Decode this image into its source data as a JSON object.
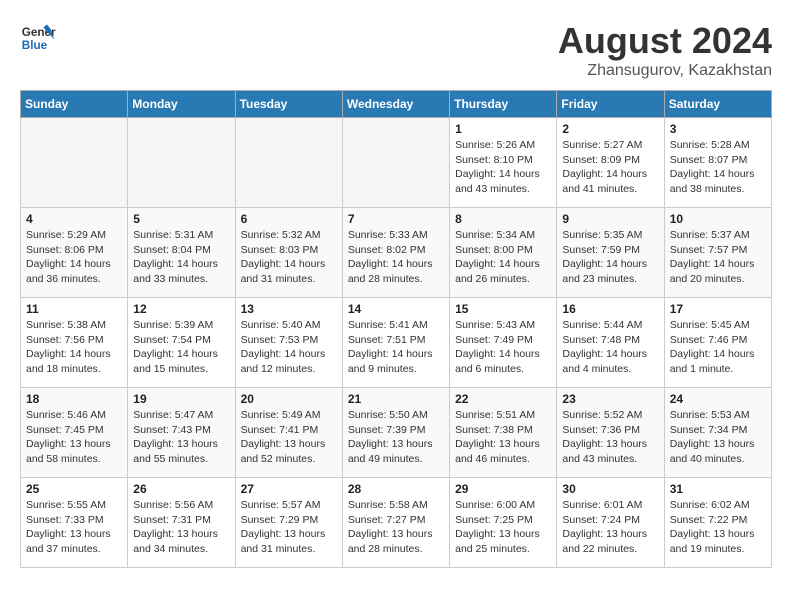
{
  "header": {
    "logo_line1": "General",
    "logo_line2": "Blue",
    "main_title": "August 2024",
    "subtitle": "Zhansugurov, Kazakhstan"
  },
  "calendar": {
    "weekdays": [
      "Sunday",
      "Monday",
      "Tuesday",
      "Wednesday",
      "Thursday",
      "Friday",
      "Saturday"
    ],
    "weeks": [
      [
        {
          "day": "",
          "info": ""
        },
        {
          "day": "",
          "info": ""
        },
        {
          "day": "",
          "info": ""
        },
        {
          "day": "",
          "info": ""
        },
        {
          "day": "1",
          "info": "Sunrise: 5:26 AM\nSunset: 8:10 PM\nDaylight: 14 hours\nand 43 minutes."
        },
        {
          "day": "2",
          "info": "Sunrise: 5:27 AM\nSunset: 8:09 PM\nDaylight: 14 hours\nand 41 minutes."
        },
        {
          "day": "3",
          "info": "Sunrise: 5:28 AM\nSunset: 8:07 PM\nDaylight: 14 hours\nand 38 minutes."
        }
      ],
      [
        {
          "day": "4",
          "info": "Sunrise: 5:29 AM\nSunset: 8:06 PM\nDaylight: 14 hours\nand 36 minutes."
        },
        {
          "day": "5",
          "info": "Sunrise: 5:31 AM\nSunset: 8:04 PM\nDaylight: 14 hours\nand 33 minutes."
        },
        {
          "day": "6",
          "info": "Sunrise: 5:32 AM\nSunset: 8:03 PM\nDaylight: 14 hours\nand 31 minutes."
        },
        {
          "day": "7",
          "info": "Sunrise: 5:33 AM\nSunset: 8:02 PM\nDaylight: 14 hours\nand 28 minutes."
        },
        {
          "day": "8",
          "info": "Sunrise: 5:34 AM\nSunset: 8:00 PM\nDaylight: 14 hours\nand 26 minutes."
        },
        {
          "day": "9",
          "info": "Sunrise: 5:35 AM\nSunset: 7:59 PM\nDaylight: 14 hours\nand 23 minutes."
        },
        {
          "day": "10",
          "info": "Sunrise: 5:37 AM\nSunset: 7:57 PM\nDaylight: 14 hours\nand 20 minutes."
        }
      ],
      [
        {
          "day": "11",
          "info": "Sunrise: 5:38 AM\nSunset: 7:56 PM\nDaylight: 14 hours\nand 18 minutes."
        },
        {
          "day": "12",
          "info": "Sunrise: 5:39 AM\nSunset: 7:54 PM\nDaylight: 14 hours\nand 15 minutes."
        },
        {
          "day": "13",
          "info": "Sunrise: 5:40 AM\nSunset: 7:53 PM\nDaylight: 14 hours\nand 12 minutes."
        },
        {
          "day": "14",
          "info": "Sunrise: 5:41 AM\nSunset: 7:51 PM\nDaylight: 14 hours\nand 9 minutes."
        },
        {
          "day": "15",
          "info": "Sunrise: 5:43 AM\nSunset: 7:49 PM\nDaylight: 14 hours\nand 6 minutes."
        },
        {
          "day": "16",
          "info": "Sunrise: 5:44 AM\nSunset: 7:48 PM\nDaylight: 14 hours\nand 4 minutes."
        },
        {
          "day": "17",
          "info": "Sunrise: 5:45 AM\nSunset: 7:46 PM\nDaylight: 14 hours\nand 1 minute."
        }
      ],
      [
        {
          "day": "18",
          "info": "Sunrise: 5:46 AM\nSunset: 7:45 PM\nDaylight: 13 hours\nand 58 minutes."
        },
        {
          "day": "19",
          "info": "Sunrise: 5:47 AM\nSunset: 7:43 PM\nDaylight: 13 hours\nand 55 minutes."
        },
        {
          "day": "20",
          "info": "Sunrise: 5:49 AM\nSunset: 7:41 PM\nDaylight: 13 hours\nand 52 minutes."
        },
        {
          "day": "21",
          "info": "Sunrise: 5:50 AM\nSunset: 7:39 PM\nDaylight: 13 hours\nand 49 minutes."
        },
        {
          "day": "22",
          "info": "Sunrise: 5:51 AM\nSunset: 7:38 PM\nDaylight: 13 hours\nand 46 minutes."
        },
        {
          "day": "23",
          "info": "Sunrise: 5:52 AM\nSunset: 7:36 PM\nDaylight: 13 hours\nand 43 minutes."
        },
        {
          "day": "24",
          "info": "Sunrise: 5:53 AM\nSunset: 7:34 PM\nDaylight: 13 hours\nand 40 minutes."
        }
      ],
      [
        {
          "day": "25",
          "info": "Sunrise: 5:55 AM\nSunset: 7:33 PM\nDaylight: 13 hours\nand 37 minutes."
        },
        {
          "day": "26",
          "info": "Sunrise: 5:56 AM\nSunset: 7:31 PM\nDaylight: 13 hours\nand 34 minutes."
        },
        {
          "day": "27",
          "info": "Sunrise: 5:57 AM\nSunset: 7:29 PM\nDaylight: 13 hours\nand 31 minutes."
        },
        {
          "day": "28",
          "info": "Sunrise: 5:58 AM\nSunset: 7:27 PM\nDaylight: 13 hours\nand 28 minutes."
        },
        {
          "day": "29",
          "info": "Sunrise: 6:00 AM\nSunset: 7:25 PM\nDaylight: 13 hours\nand 25 minutes."
        },
        {
          "day": "30",
          "info": "Sunrise: 6:01 AM\nSunset: 7:24 PM\nDaylight: 13 hours\nand 22 minutes."
        },
        {
          "day": "31",
          "info": "Sunrise: 6:02 AM\nSunset: 7:22 PM\nDaylight: 13 hours\nand 19 minutes."
        }
      ]
    ]
  }
}
